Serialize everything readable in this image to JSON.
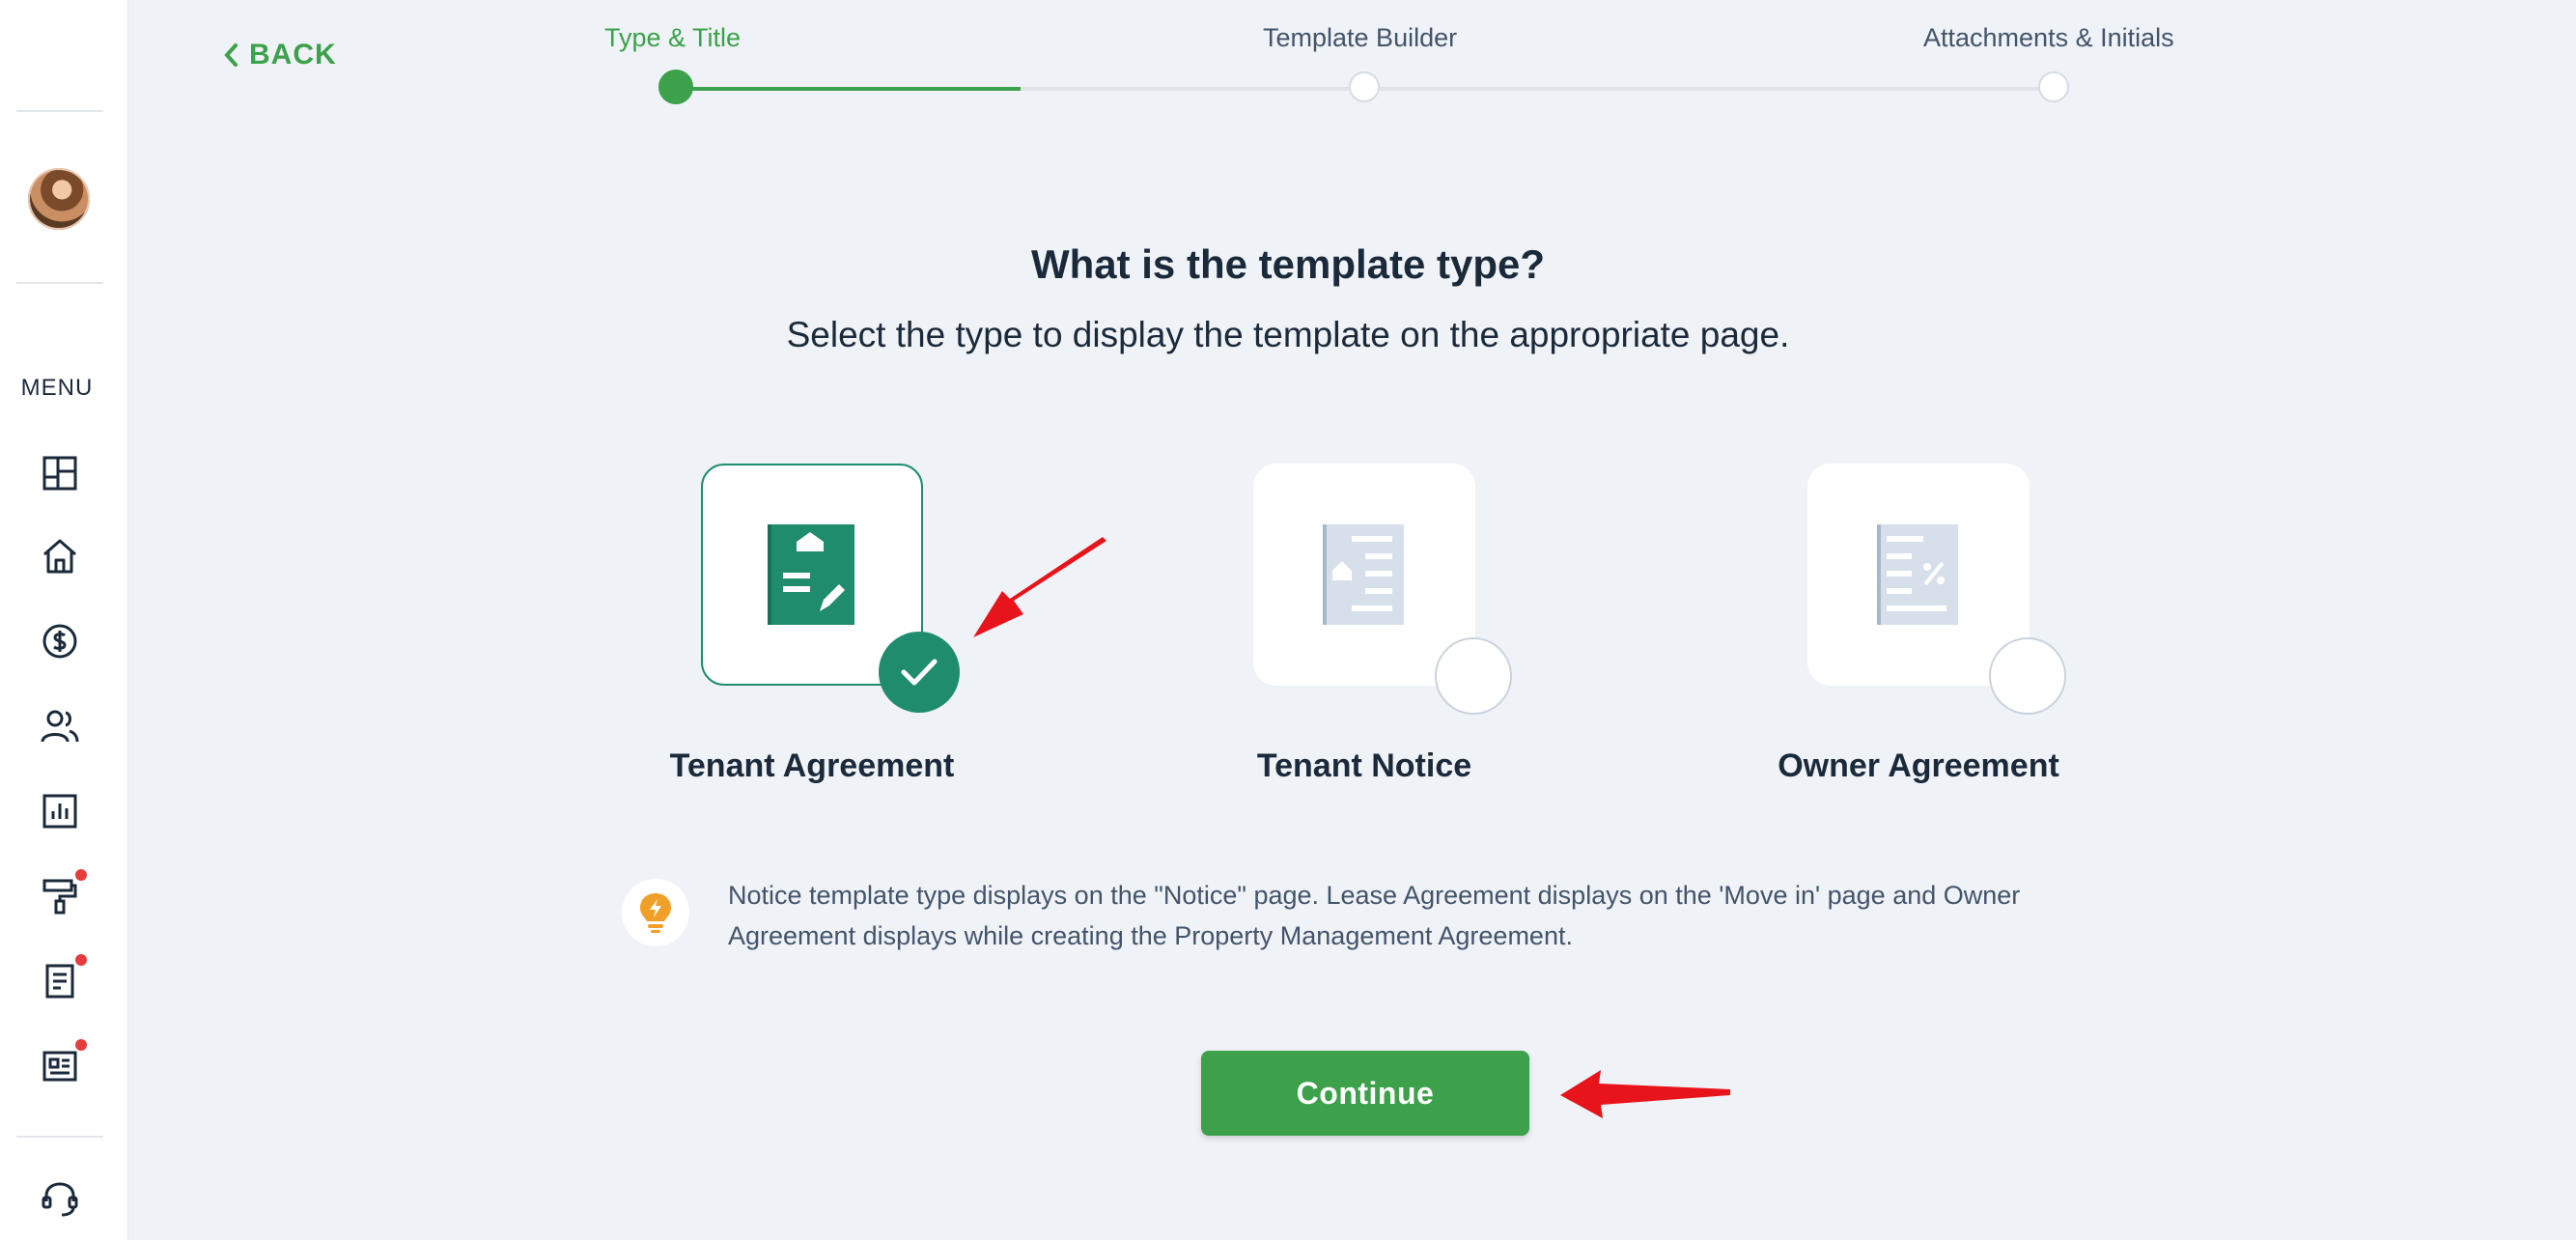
{
  "sidebar": {
    "menu_label": "MENU",
    "items": [
      {
        "icon": "dashboard-icon"
      },
      {
        "icon": "home-icon"
      },
      {
        "icon": "dollar-icon"
      },
      {
        "icon": "users-icon"
      },
      {
        "icon": "reports-icon"
      },
      {
        "icon": "paint-roller-icon",
        "badge": true
      },
      {
        "icon": "document-icon",
        "badge": true
      },
      {
        "icon": "news-icon",
        "badge": true
      },
      {
        "icon": "support-headset-icon"
      }
    ]
  },
  "header": {
    "back_label": "BACK",
    "steps": [
      {
        "label": "Type & Title",
        "active": true
      },
      {
        "label": "Template Builder",
        "active": false
      },
      {
        "label": "Attachments & Initials",
        "active": false
      }
    ]
  },
  "main": {
    "title": "What is the template type?",
    "subtitle": "Select the type to display the template on the appropriate page.",
    "options": [
      {
        "label": "Tenant Agreement",
        "selected": true
      },
      {
        "label": "Tenant Notice",
        "selected": false
      },
      {
        "label": "Owner Agreement",
        "selected": false
      }
    ],
    "info_text": "Notice template type displays on the \"Notice\" page. Lease Agreement displays on the 'Move in' page and Owner Agreement displays while creating the Property Management Agreement.",
    "continue_label": "Continue"
  },
  "colors": {
    "accent_green": "#3ca14a",
    "selected_teal": "#1f8d6d",
    "annotation_red": "#e8141b"
  }
}
